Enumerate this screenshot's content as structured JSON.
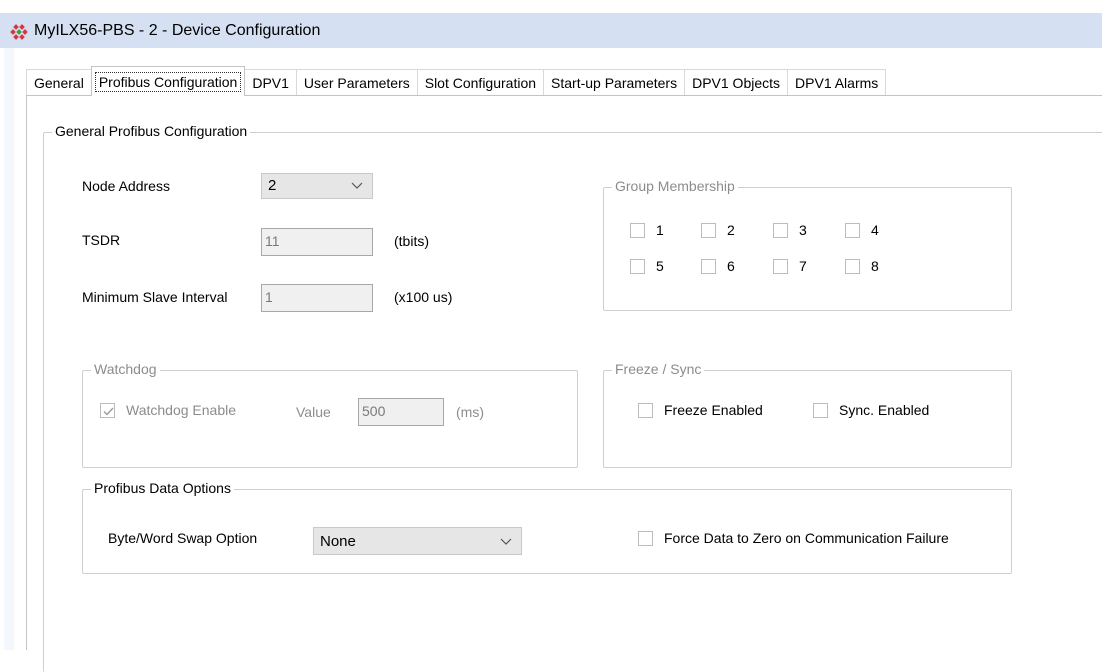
{
  "window": {
    "title": "MyILX56-PBS - 2 - Device Configuration"
  },
  "tabs": [
    {
      "label": "General"
    },
    {
      "label": "Profibus Configuration"
    },
    {
      "label": "DPV1"
    },
    {
      "label": "User Parameters"
    },
    {
      "label": "Slot Configuration"
    },
    {
      "label": "Start-up Parameters"
    },
    {
      "label": "DPV1 Objects"
    },
    {
      "label": "DPV1 Alarms"
    }
  ],
  "active_tab": "Profibus Configuration",
  "general": {
    "legend": "General Profibus Configuration",
    "node_address_label": "Node Address",
    "node_address_value": "2",
    "tsdr_label": "TSDR",
    "tsdr_value": "11",
    "tsdr_unit": "(tbits)",
    "min_slave_label": "Minimum Slave Interval",
    "min_slave_value": "1",
    "min_slave_unit": "(x100 us)"
  },
  "group_membership": {
    "legend": "Group Membership",
    "items": [
      {
        "label": "1",
        "checked": false
      },
      {
        "label": "2",
        "checked": false
      },
      {
        "label": "3",
        "checked": false
      },
      {
        "label": "4",
        "checked": false
      },
      {
        "label": "5",
        "checked": false
      },
      {
        "label": "6",
        "checked": false
      },
      {
        "label": "7",
        "checked": false
      },
      {
        "label": "8",
        "checked": false
      }
    ]
  },
  "watchdog": {
    "legend": "Watchdog",
    "enable_label": "Watchdog Enable",
    "enable_checked": true,
    "value_label": "Value",
    "value": "500",
    "unit": "(ms)"
  },
  "freeze_sync": {
    "legend": "Freeze / Sync",
    "freeze_label": "Freeze Enabled",
    "freeze_checked": false,
    "sync_label": "Sync. Enabled",
    "sync_checked": false
  },
  "data_options": {
    "legend": "Profibus Data Options",
    "swap_label": "Byte/Word Swap Option",
    "swap_value": "None",
    "force_zero_label": "Force Data to Zero on Communication Failure",
    "force_zero_checked": false
  },
  "icons": {
    "app": "device-config-icon",
    "dropdown": "chevron-down-icon",
    "check": "check-icon"
  },
  "colors": {
    "titlebar": "#d5e1f2",
    "disabled_text": "#8c8c8c",
    "combo_bg": "#e6e6e6"
  }
}
